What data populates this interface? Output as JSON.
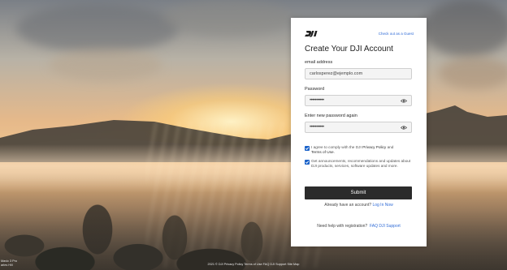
{
  "header": {
    "guest_link": "Check out as a Guest"
  },
  "form": {
    "title": "Create Your DJI Account",
    "email_label": "email address",
    "email_value": "carlosperez@ejemplo.com",
    "password_label": "Password",
    "password_value": "•••••••••••",
    "confirm_label": "Enter new password again",
    "confirm_value": "•••••••••••",
    "agree_prefix": "I agree to comply with the DJI",
    "privacy_link": "Privacy Policy",
    "and": "and",
    "terms_link": "Terms of Use",
    "terms_suffix": ".",
    "marketing_text": "Get announcements, recommendations and updates about DJI products, services, software updates and more.",
    "submit_label": "Submit",
    "have_account": "Already have an account?",
    "login_link": "Log In Now",
    "help_text": "Need help with registration?",
    "help_link": "FAQ  DJI Support"
  },
  "footer": {
    "text": "2021 © DJI Privacy Policy Terms of Use FAQ DJI Support Site Map"
  },
  "photo_caption": {
    "line1": "Mavic 3 Pro",
    "line2": "arles Hill"
  },
  "colors": {
    "accent": "#1a62c9",
    "link": "#2f6bd6",
    "button": "#2b2b2b"
  },
  "icons": {
    "logo": "dji-logo",
    "eye": "eye-icon",
    "check": "checkmark-icon"
  }
}
